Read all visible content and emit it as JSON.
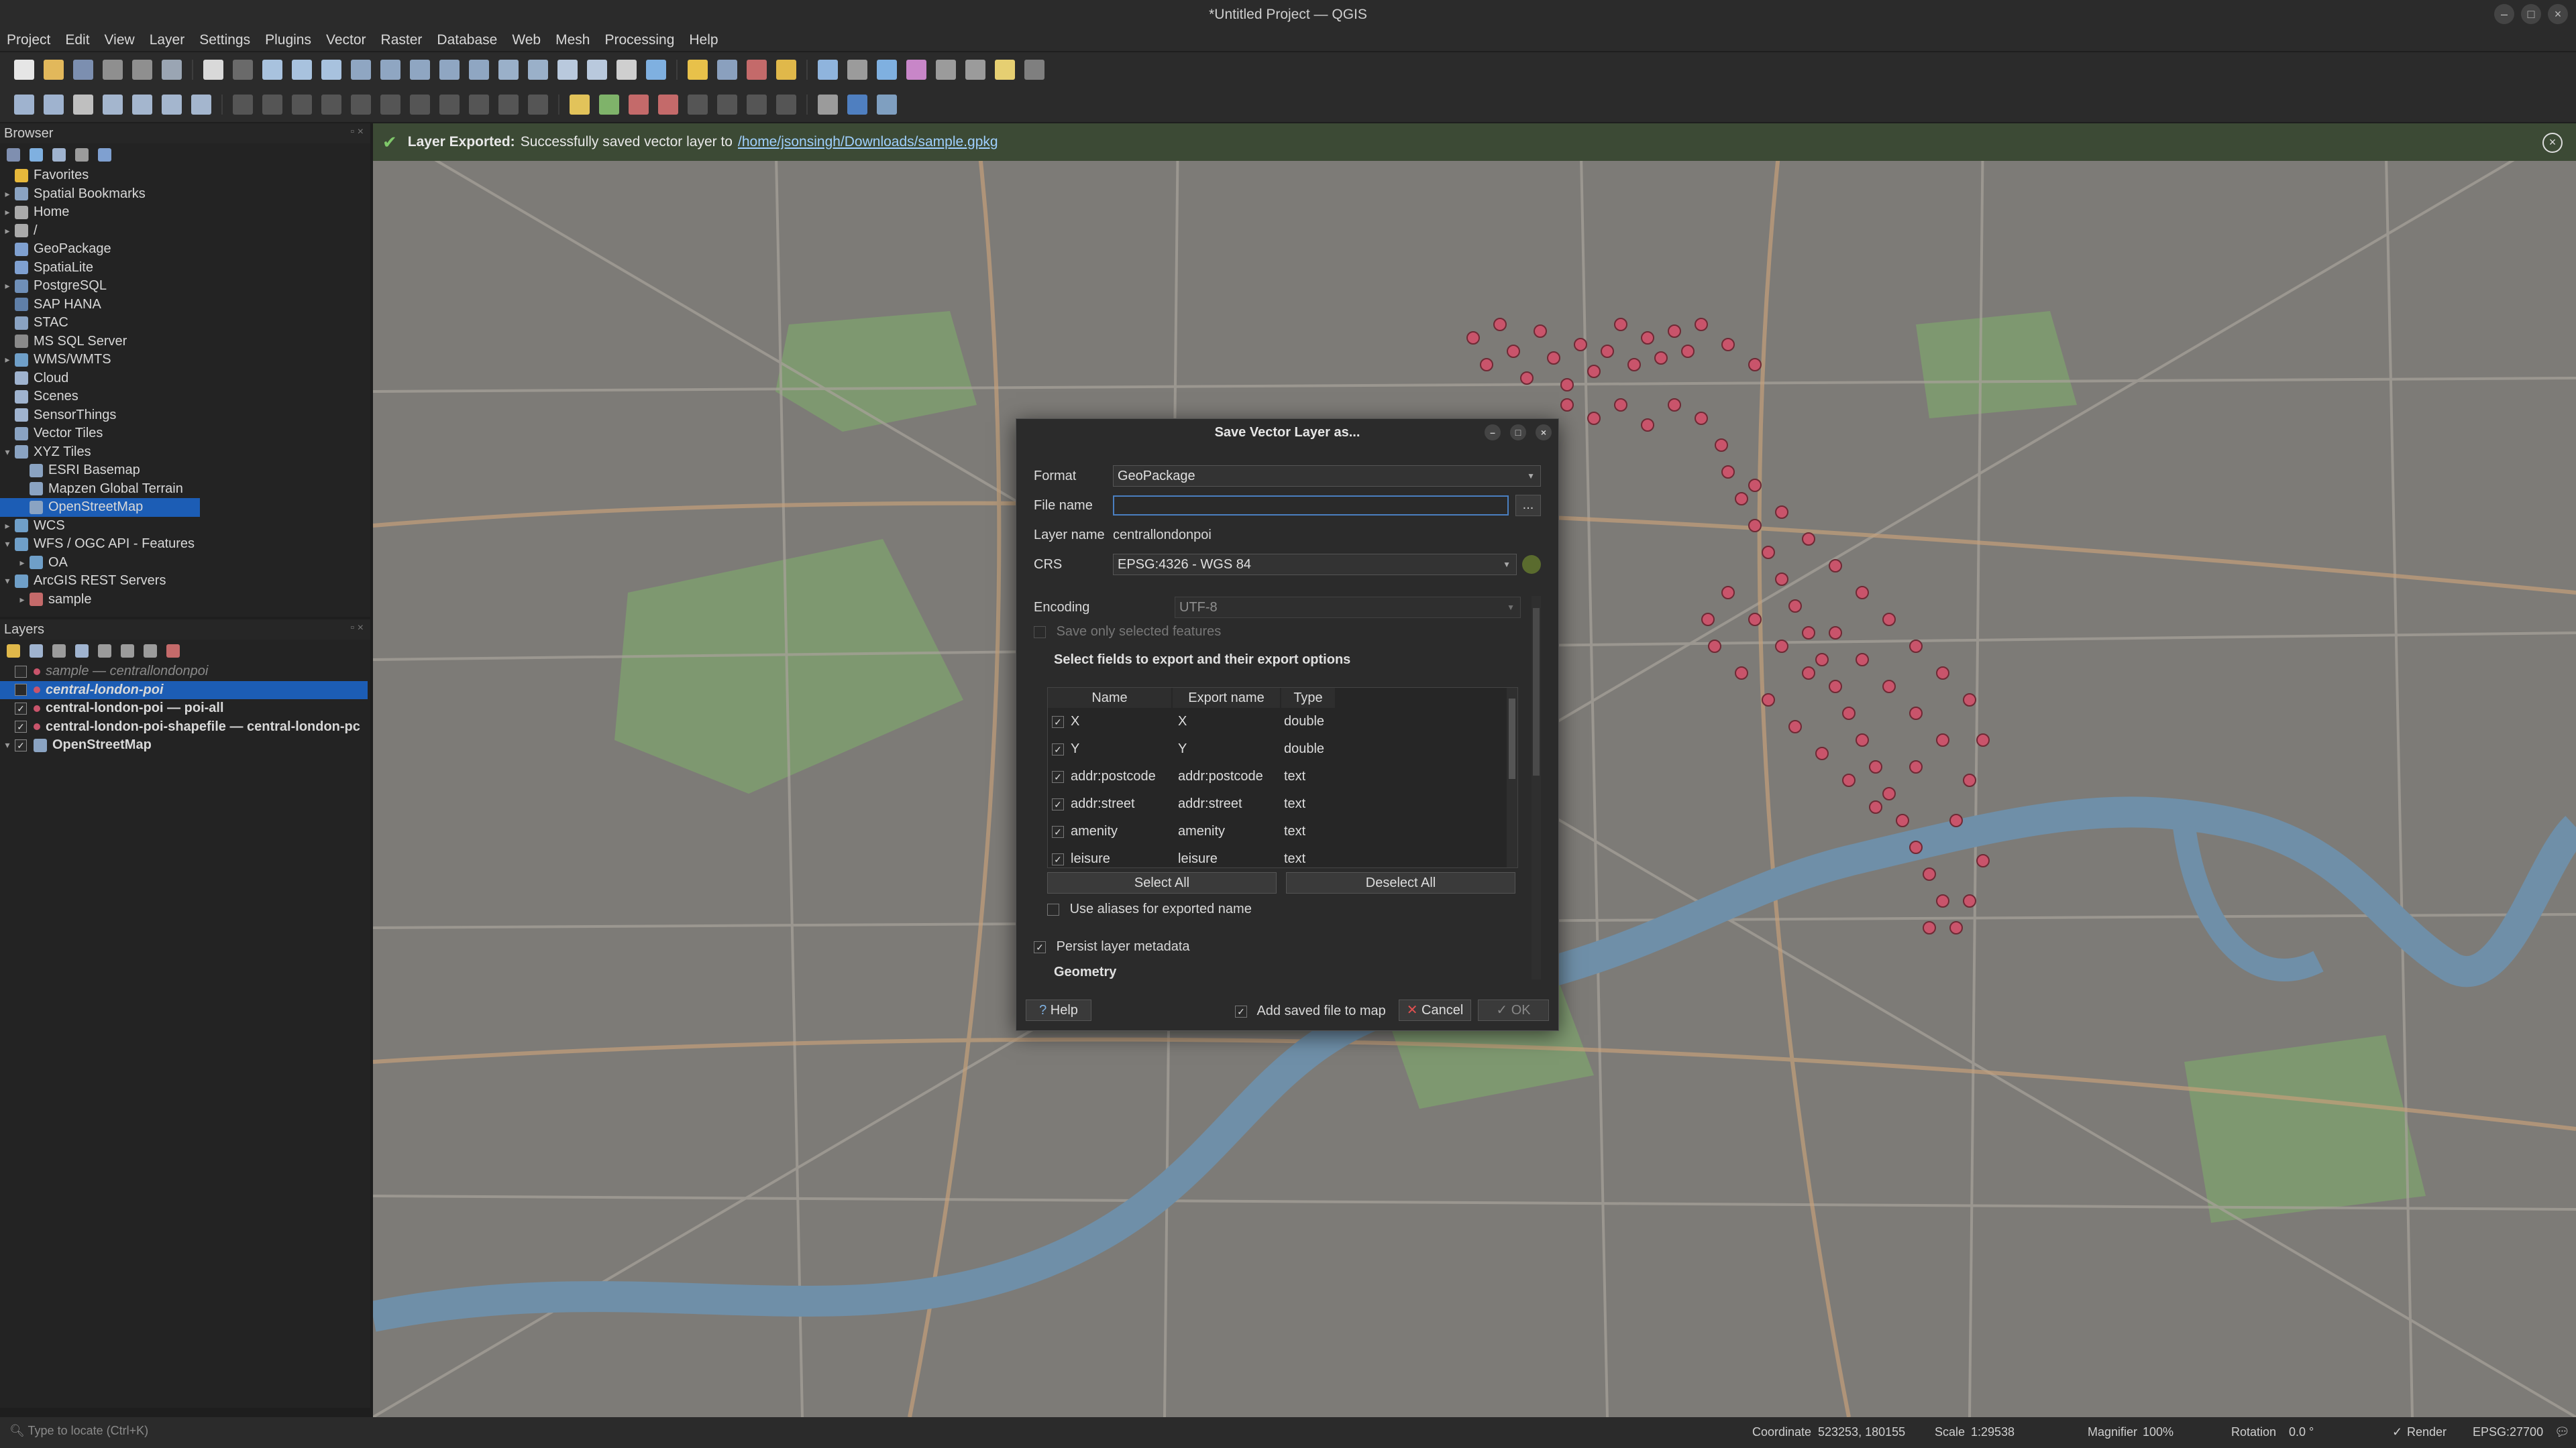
{
  "window": {
    "title": "*Untitled Project — QGIS"
  },
  "menubar": [
    "Project",
    "Edit",
    "View",
    "Layer",
    "Settings",
    "Plugins",
    "Vector",
    "Raster",
    "Database",
    "Web",
    "Mesh",
    "Processing",
    "Help"
  ],
  "browser": {
    "title": "Browser",
    "items": [
      {
        "label": "Favorites",
        "icon": "star-icon"
      },
      {
        "label": "Spatial Bookmarks",
        "icon": "bookmark-icon"
      },
      {
        "label": "Home",
        "icon": "folder-icon"
      },
      {
        "label": "/",
        "icon": "folder-icon"
      },
      {
        "label": "GeoPackage",
        "icon": "geopackage-icon"
      },
      {
        "label": "SpatiaLite",
        "icon": "spatialite-icon"
      },
      {
        "label": "PostgreSQL",
        "icon": "postgresql-icon"
      },
      {
        "label": "SAP HANA",
        "icon": "database-icon"
      },
      {
        "label": "STAC",
        "icon": "stac-icon"
      },
      {
        "label": "MS SQL Server",
        "icon": "database-icon"
      },
      {
        "label": "WMS/WMTS",
        "icon": "globe-icon"
      },
      {
        "label": "Cloud",
        "icon": "cloud-icon"
      },
      {
        "label": "Scenes",
        "icon": "scene-icon"
      },
      {
        "label": "SensorThings",
        "icon": "sensor-icon"
      },
      {
        "label": "Vector Tiles",
        "icon": "grid-icon"
      },
      {
        "label": "XYZ Tiles",
        "icon": "grid-icon"
      },
      {
        "label": "ESRI Basemap",
        "icon": "grid-icon"
      },
      {
        "label": "Mapzen Global Terrain",
        "icon": "grid-icon"
      },
      {
        "label": "OpenStreetMap",
        "icon": "grid-icon"
      },
      {
        "label": "WCS",
        "icon": "globe-icon"
      },
      {
        "label": "WFS / OGC API - Features",
        "icon": "globe-icon"
      },
      {
        "label": "OA",
        "icon": "globe-icon"
      },
      {
        "label": "ArcGIS REST Servers",
        "icon": "globe-icon"
      },
      {
        "label": "sample",
        "icon": "layer-icon"
      }
    ]
  },
  "layers": {
    "title": "Layers",
    "items": [
      {
        "label": "sample — centrallondonpoi"
      },
      {
        "label": "central-london-poi"
      },
      {
        "label": "central-london-poi — poi-all"
      },
      {
        "label": "central-london-poi-shapefile — central-london-pc"
      },
      {
        "label": "OpenStreetMap"
      }
    ]
  },
  "message": {
    "title": "Layer Exported:",
    "text": "Successfully saved vector layer to",
    "link": "/home/jsonsingh/Downloads/sample.gpkg"
  },
  "dialog": {
    "title": "Save Vector Layer as...",
    "format_label": "Format",
    "format_value": "GeoPackage",
    "filename_label": "File name",
    "browse_label": "...",
    "layername_label": "Layer name",
    "layername_value": "centrallondonpoi",
    "crs_label": "CRS",
    "crs_value": "EPSG:4326 - WGS 84",
    "encoding_label": "Encoding",
    "encoding_value": "UTF-8",
    "save_selected_label": "Save only selected features",
    "select_fields_label": "Select fields to export and their export options",
    "columns": [
      "Name",
      "Export name",
      "Type"
    ],
    "fields": [
      {
        "name": "X",
        "export": "X",
        "type": "double"
      },
      {
        "name": "Y",
        "export": "Y",
        "type": "double"
      },
      {
        "name": "addr:postcode",
        "export": "addr:postcode",
        "type": "text"
      },
      {
        "name": "addr:street",
        "export": "addr:street",
        "type": "text"
      },
      {
        "name": "amenity",
        "export": "amenity",
        "type": "text"
      },
      {
        "name": "leisure",
        "export": "leisure",
        "type": "text"
      }
    ],
    "select_all_label": "Select All",
    "deselect_all_label": "Deselect All",
    "use_aliases_label": "Use aliases for exported name",
    "persist_metadata_label": "Persist layer metadata",
    "geometry_label": "Geometry",
    "help_label": "Help",
    "add_to_map_label": "Add saved file to map",
    "cancel_label": "Cancel",
    "ok_label": "OK"
  },
  "statusbar": {
    "locate_placeholder": "Type to locate (Ctrl+K)",
    "coordinate_label": "Coordinate",
    "coordinate_value": "523253, 180155",
    "scale_label": "Scale",
    "scale_value": "1:29538",
    "magnifier_label": "Magnifier",
    "magnifier_value": "100%",
    "rotation_label": "Rotation",
    "rotation_value": "0.0 °",
    "render_label": "Render",
    "crs_value": "EPSG:27700"
  },
  "colors": {
    "accent": "#1c5db5",
    "message_bg": "#3c4a35",
    "poi_marker": "#c9546b",
    "river": "#6f8fa8",
    "park": "#7e9870"
  }
}
